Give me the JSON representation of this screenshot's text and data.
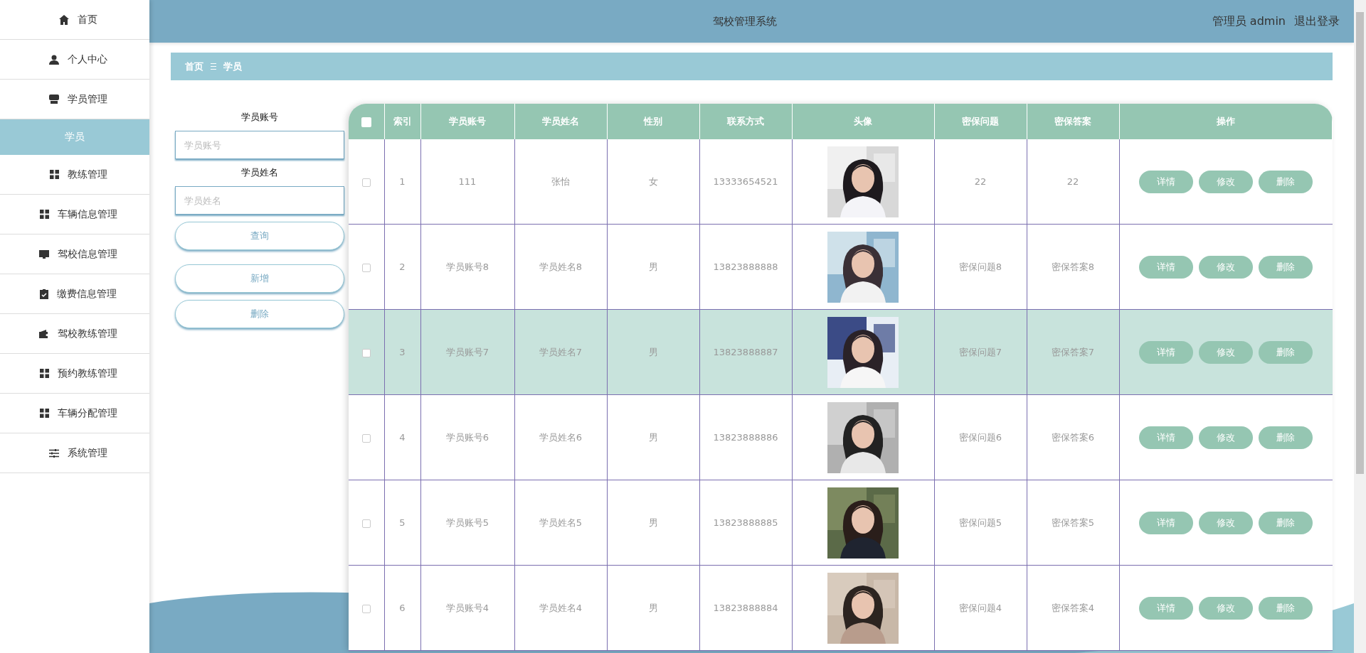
{
  "sidebar": {
    "items": [
      {
        "label": "首页",
        "selected": false
      },
      {
        "label": "个人中心",
        "selected": false
      },
      {
        "label": "学员管理",
        "selected": false,
        "expanded": true,
        "children": [
          {
            "label": "学员",
            "selected": true
          }
        ]
      },
      {
        "label": "教练管理",
        "selected": false
      },
      {
        "label": "车辆信息管理",
        "selected": false
      },
      {
        "label": "驾校信息管理",
        "selected": false
      },
      {
        "label": "缴费信息管理",
        "selected": false
      },
      {
        "label": "驾校教练管理",
        "selected": false
      },
      {
        "label": "预约教练管理",
        "selected": false
      },
      {
        "label": "车辆分配管理",
        "selected": false
      },
      {
        "label": "系统管理",
        "selected": false
      }
    ]
  },
  "header": {
    "title": "驾校管理系统",
    "user": "管理员 admin",
    "logout": "退出登录"
  },
  "breadcrumb": [
    "首页",
    "学员"
  ],
  "search": {
    "fields": [
      {
        "label": "学员账号",
        "placeholder": "学员账号"
      },
      {
        "label": "学员姓名",
        "placeholder": "学员姓名"
      }
    ],
    "query_button": "查询",
    "buttons": [
      "新增",
      "删除"
    ]
  },
  "table": {
    "header_checked": false,
    "columns": [
      "索引",
      "学员账号",
      "学员姓名",
      "性别",
      "联系方式",
      "头像",
      "密保问题",
      "密保答案",
      "操作"
    ],
    "rows": [
      {
        "cells": [
          "1",
          "111",
          "张怡",
          "女",
          "13333654521"
        ],
        "photo": {
          "kind": "picture"
        },
        "after": [
          "22",
          "22"
        ],
        "actions": [
          "详情",
          "修改",
          "删除"
        ],
        "checked": false,
        "selected": false
      },
      {
        "cells": [
          "2",
          "学员账号8",
          "学员姓名8",
          "男",
          "13823888888"
        ],
        "photo": {
          "kind": "picture"
        },
        "after": [
          "密保问题8",
          "密保答案8"
        ],
        "actions": [
          "详情",
          "修改",
          "删除"
        ],
        "checked": false,
        "selected": false
      },
      {
        "cells": [
          "3",
          "学员账号7",
          "学员姓名7",
          "男",
          "13823888887"
        ],
        "photo": {
          "kind": "picture"
        },
        "after": [
          "密保问题7",
          "密保答案7"
        ],
        "actions": [
          "详情",
          "修改",
          "删除"
        ],
        "checked": false,
        "selected": true
      },
      {
        "cells": [
          "4",
          "学员账号6",
          "学员姓名6",
          "男",
          "13823888886"
        ],
        "photo": {
          "kind": "picture"
        },
        "after": [
          "密保问题6",
          "密保答案6"
        ],
        "actions": [
          "详情",
          "修改",
          "删除"
        ],
        "checked": false,
        "selected": false
      },
      {
        "cells": [
          "5",
          "学员账号5",
          "学员姓名5",
          "男",
          "13823888885"
        ],
        "photo": {
          "kind": "picture"
        },
        "after": [
          "密保问题5",
          "密保答案5"
        ],
        "actions": [
          "详情",
          "修改",
          "删除"
        ],
        "checked": false,
        "selected": false
      },
      {
        "cells": [
          "6",
          "学员账号4",
          "学员姓名4",
          "男",
          "13823888884"
        ],
        "photo": {
          "kind": "picture"
        },
        "after": [
          "密保问题4",
          "密保答案4"
        ],
        "actions": [
          "详情",
          "修改",
          "删除"
        ],
        "checked": false,
        "selected": false
      }
    ]
  }
}
